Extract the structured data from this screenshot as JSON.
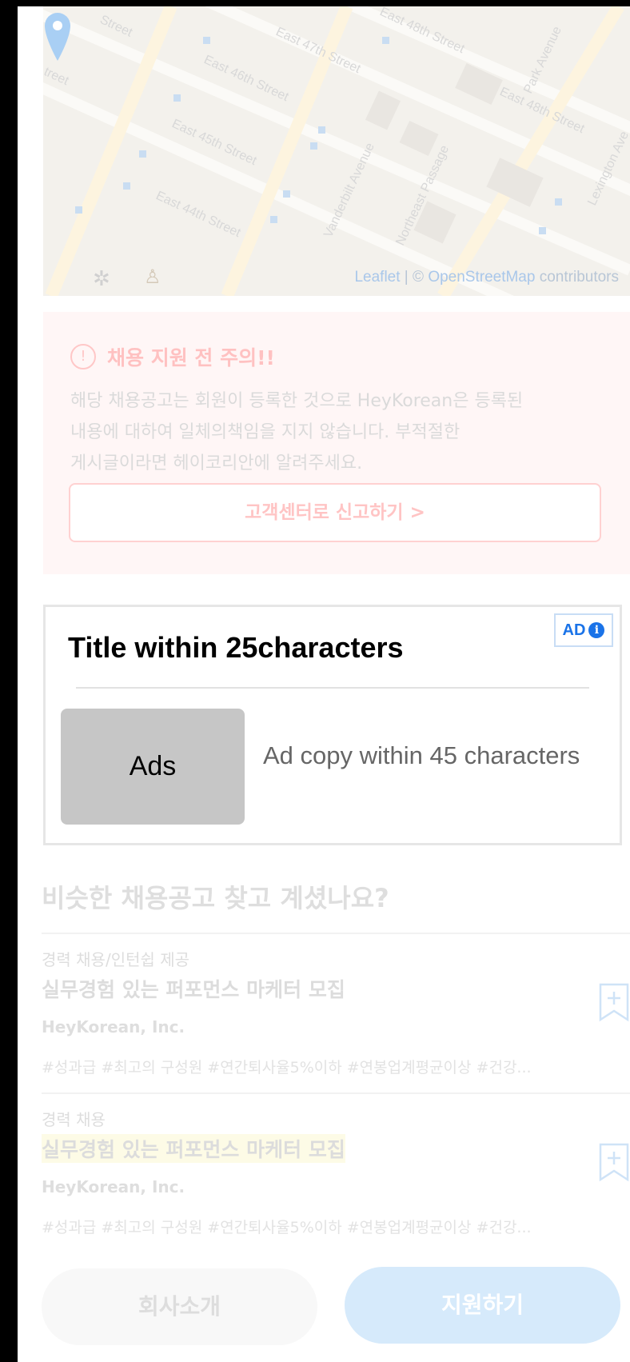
{
  "map": {
    "streets": [
      "Street",
      "treet",
      "East 47th Street",
      "East 48th Street",
      "East 46th Street",
      "East 45th Street",
      "East 44th Street",
      "East 48th Street",
      "Vanderbilt Avenue",
      "Northeast Passage",
      "Park Avenue",
      "Lexington Ave"
    ],
    "attribution_leaflet": "Leaflet",
    "attribution_sep": " | © ",
    "attribution_osm": "OpenStreetMap",
    "attribution_rest": " contributors"
  },
  "notice": {
    "icon": "!",
    "title": "채용 지원 전 주의!!",
    "line1": "해당 채용공고는 회원이 등록한 것으로 HeyKorean은 등록된",
    "line2": "내용에 대하여 일체의책임을 지지 않습니다. 부적절한",
    "line3": "게시글이라면 헤이코리안에 알려주세요.",
    "report_button": "고객센터로 신고하기 >"
  },
  "ad": {
    "badge": "AD",
    "badge_icon": "i",
    "title": "Title within 25characters",
    "thumb_label": "Ads",
    "copy": "Ad copy within 45 characters"
  },
  "similar": {
    "heading": "비슷한 채용공고 찾고 계셨나요?",
    "jobs": [
      {
        "type": "경력 채용/인턴쉽 제공",
        "title": "실무경험 있는 퍼포먼스 마케터 모집",
        "company": "HeyKorean, Inc.",
        "tags": "#성과급 #최고의 구성원 #연간퇴사율5%이하 #연봉업계평균이상 #건강..."
      },
      {
        "type": "경력 채용",
        "title": "실무경험 있는 퍼포먼스 마케터 모집",
        "company": "HeyKorean, Inc.",
        "tags": "#성과급 #최고의 구성원 #연간퇴사율5%이하 #연봉업계평균이상 #건강..."
      }
    ]
  },
  "bottom": {
    "company_button": "회사소개",
    "apply_button": "지원하기"
  }
}
